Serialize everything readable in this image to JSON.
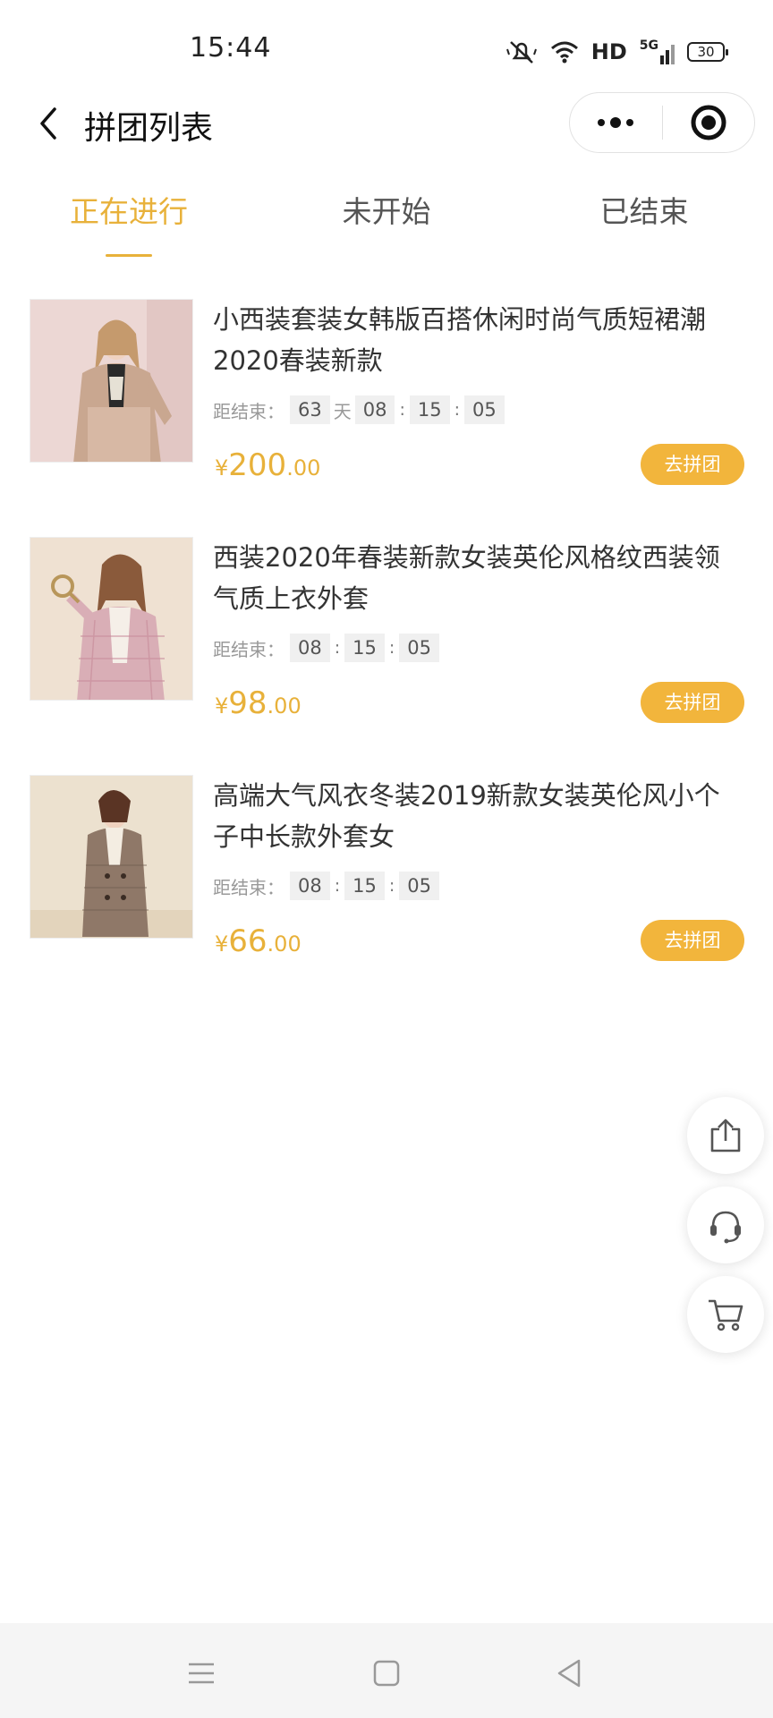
{
  "status_bar": {
    "time": "15:44",
    "hd": "HD",
    "network": "5G",
    "battery": "30"
  },
  "nav": {
    "title": "拼团列表"
  },
  "tabs": [
    {
      "label": "正在进行",
      "active": true
    },
    {
      "label": "未开始",
      "active": false
    },
    {
      "label": "已结束",
      "active": false
    }
  ],
  "countdown_label": "距结束：",
  "day_unit": "天",
  "time_sep": ":",
  "currency": "¥",
  "join_label": "去拼团",
  "products": [
    {
      "title": "小西装套装女韩版百搭休闲时尚气质短裙潮2020春装新款",
      "days": "63",
      "hours": "08",
      "minutes": "15",
      "seconds": "05",
      "price_int": "200",
      "price_dec": ".00"
    },
    {
      "title": "西装2020年春装新款女装英伦风格纹西装领气质上衣外套",
      "hours": "08",
      "minutes": "15",
      "seconds": "05",
      "price_int": "98",
      "price_dec": ".00"
    },
    {
      "title": "高端大气风衣冬装2019新款女装英伦风小个子中长款外套女",
      "hours": "08",
      "minutes": "15",
      "seconds": "05",
      "price_int": "66",
      "price_dec": ".00"
    }
  ],
  "floating_buttons": [
    {
      "icon": "share-icon"
    },
    {
      "icon": "customer-service-icon"
    },
    {
      "icon": "cart-icon"
    }
  ],
  "colors": {
    "accent": "#e8b13a",
    "button": "#f2b53c"
  }
}
